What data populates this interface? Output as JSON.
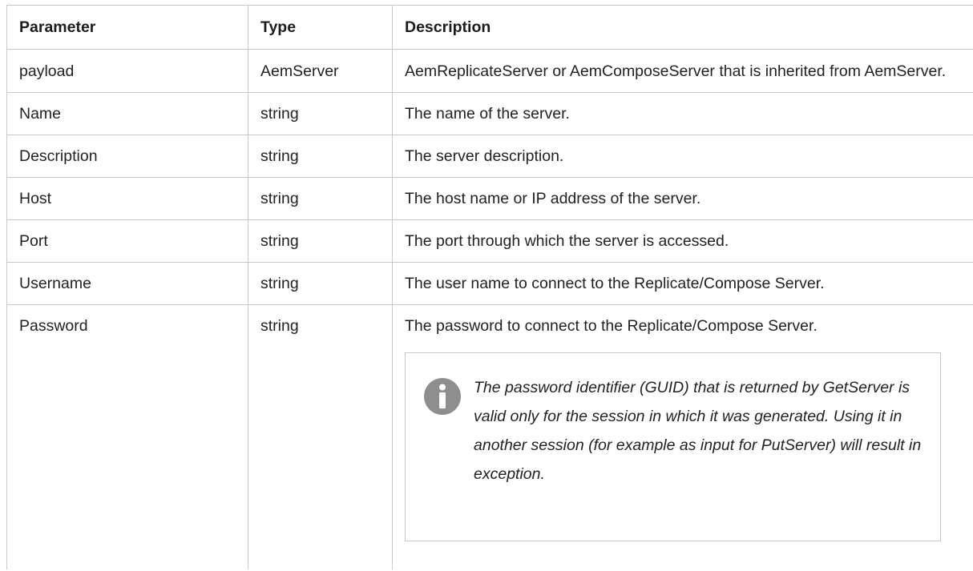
{
  "table": {
    "headers": [
      "Parameter",
      "Type",
      "Description"
    ],
    "rows": [
      {
        "parameter": "payload",
        "type": "AemServer",
        "description": "AemReplicateServer or AemComposeServer that is inherited from AemServer."
      },
      {
        "parameter": "Name",
        "type": "string",
        "description": "The name of the server."
      },
      {
        "parameter": "Description",
        "type": "string",
        "description": "The server description."
      },
      {
        "parameter": "Host",
        "type": "string",
        "description": "The host name or IP address of the server."
      },
      {
        "parameter": "Port",
        "type": "string",
        "description": "The port through which the server is accessed."
      },
      {
        "parameter": "Username",
        "type": "string",
        "description": "The user name to connect to the Replicate/Compose Server."
      },
      {
        "parameter": "Password",
        "type": "string",
        "description": "The password to connect to the Replicate/Compose Server."
      }
    ]
  },
  "note": {
    "icon": "info-icon",
    "icon_color": "#8e8e8e",
    "text": "The password identifier (GUID) that is returned by GetServer is valid only for the session in which it was generated. Using it in another session (for example as input for PutServer) will result in exception."
  }
}
